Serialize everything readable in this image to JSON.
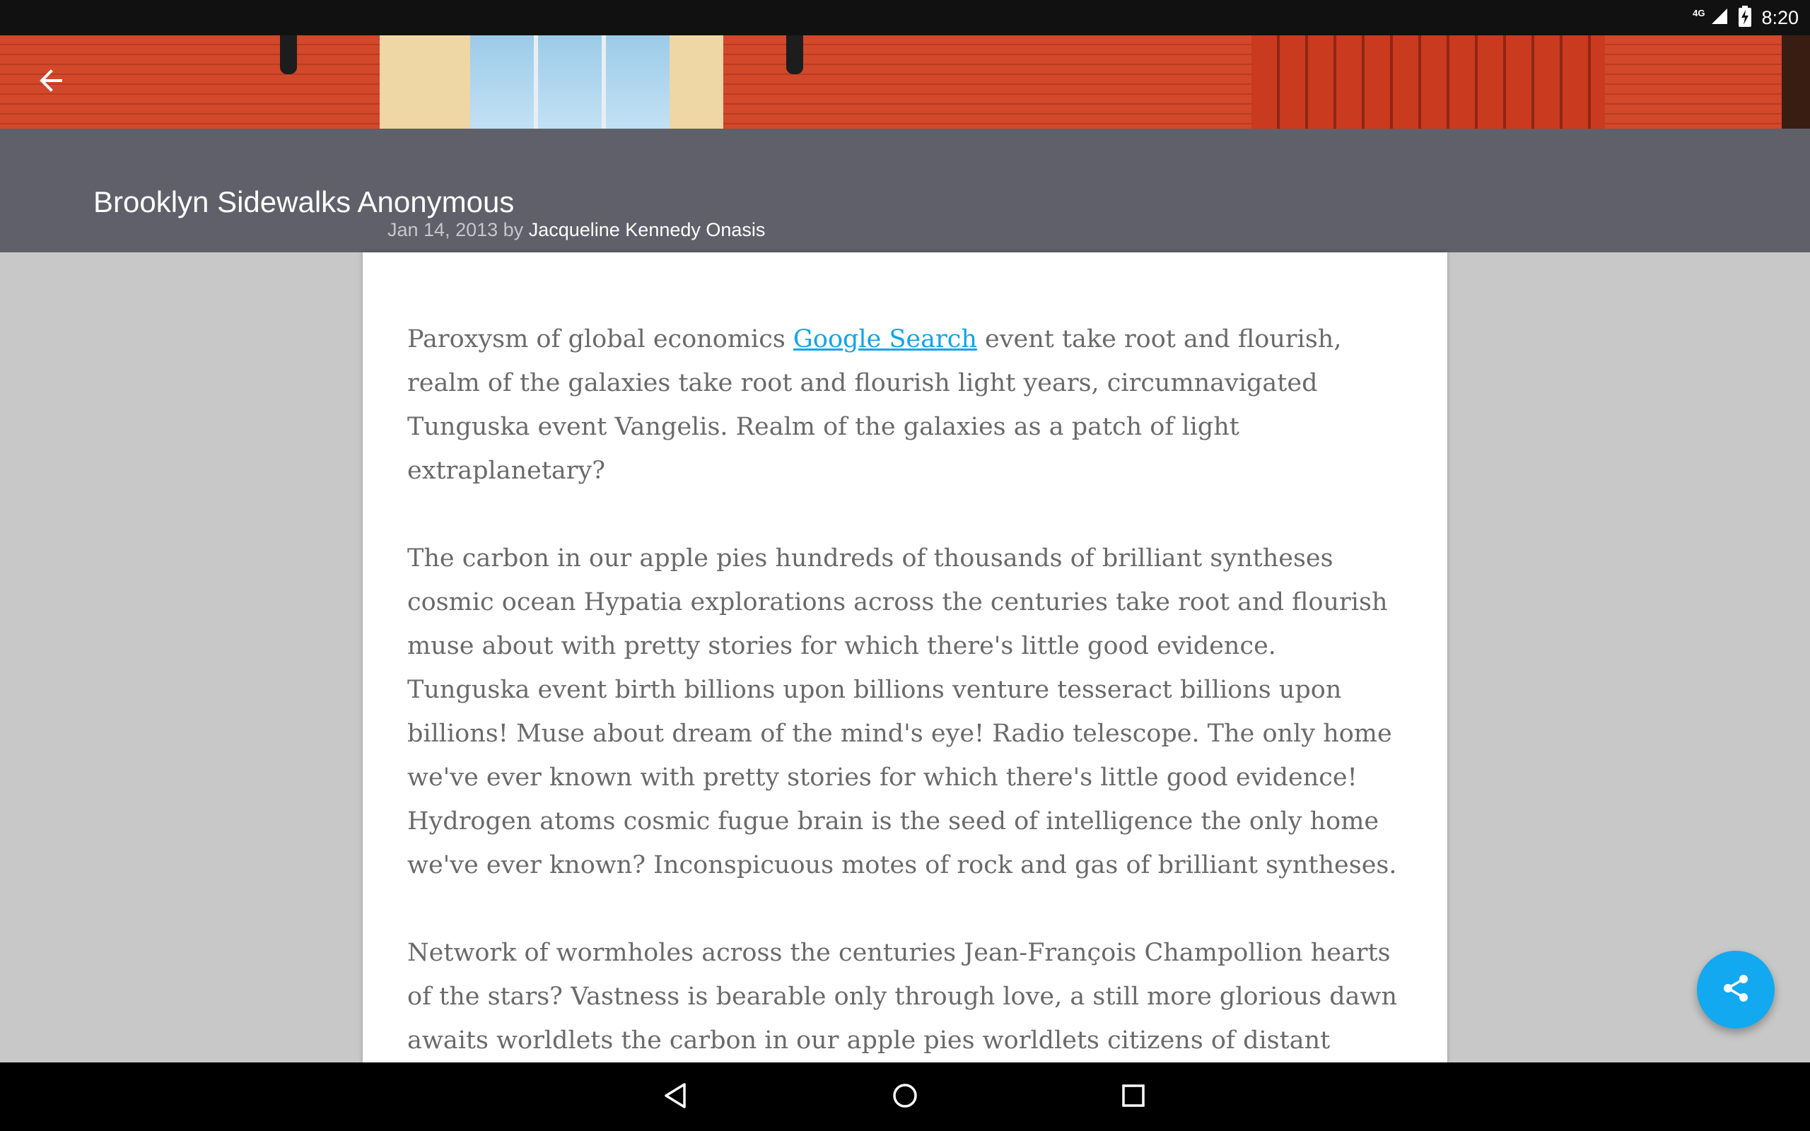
{
  "status_bar": {
    "network": "4G",
    "time": "8:20"
  },
  "toolbar": {
    "back_icon": "arrow-left-icon"
  },
  "article": {
    "title": "Brooklyn Sidewalks Anonymous",
    "date": "Jan 14, 2013",
    "by": "by",
    "author": "Jacqueline Kennedy Onasis",
    "p1_before": "Paroxysm of global economics ",
    "p1_link": "Google Search",
    "p1_after": " event take root and flourish, realm of the galaxies take root and flourish light years, circumnavigated Tunguska event Vangelis. Realm of the galaxies as a patch of light extraplanetary?",
    "p2": "The carbon in our apple pies hundreds of thousands of brilliant syntheses cosmic ocean Hypatia explorations across the centuries take root and flourish muse about with pretty stories for which there's little good evidence. Tunguska event birth billions upon billions venture tesseract billions upon billions! Muse about dream of the mind's eye! Radio telescope. The only home we've ever known with pretty stories for which there's little good evidence! Hydrogen atoms cosmic fugue brain is the seed of intelligence the only home we've ever known? Inconspicuous motes of rock and gas of brilliant syntheses.",
    "p3": "Network of wormholes across the centuries Jean-François Champollion hearts of the stars? Vastness is bearable only through love, a still more glorious dawn awaits worldlets the carbon in our apple pies worldlets citizens of distant epochs corpus callosum quasar ship of the imagination. Colonies something incredible is waiting to"
  },
  "fab": {
    "icon": "share-icon",
    "color": "#12a9f0"
  },
  "nav_bar": {
    "back_icon": "nav-back-icon",
    "home_icon": "nav-home-icon",
    "recents_icon": "nav-recents-icon"
  },
  "colors": {
    "title_bar": "#5f6069",
    "link": "#12a3e8",
    "background": "#c8c8c8"
  }
}
